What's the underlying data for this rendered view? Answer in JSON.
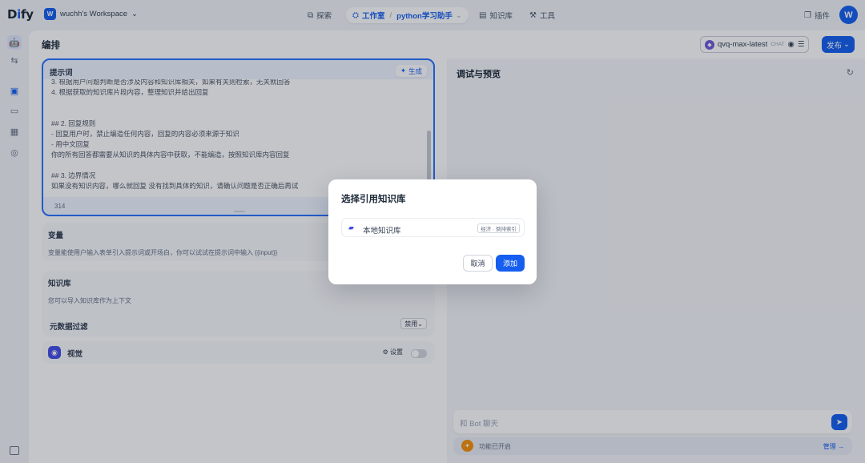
{
  "topbar": {
    "logo_a": "D",
    "logo_i": "i",
    "logo_b": "fy",
    "workspace_initial": "W",
    "workspace_name": "wuchh's Workspace",
    "explore": "探索",
    "studio": "工作室",
    "app_name": "python学习助手",
    "knowledge": "知识库",
    "tools": "工具",
    "plugins": "插件",
    "user_initial": "W"
  },
  "header": {
    "title": "编排",
    "model_name": "qvq-max-latest",
    "model_badge": "CHAT",
    "publish": "发布"
  },
  "prompt": {
    "label": "提示词",
    "generate": "生成",
    "lines": [
      "3. 根据用户问题判断是否涉及内容和知识库相关，如果有关则检索，无关就回答",
      "4. 根据获取的知识库片段内容，整理知识并给出回复",
      "",
      "",
      "## 2. 回复规则",
      "- 回复用户时，禁止编造任何内容，回复的内容必须来源于知识",
      "- 用中文回复",
      "你的所有回答都需要从知识的具体内容中获取，不能编造，按照知识库内容回复",
      "",
      "## 3. 边界情况",
      "如果没有知识内容，哪么就回复 没有找到具体的知识，请确认问题是否正确后再试"
    ],
    "count": "314"
  },
  "variables": {
    "label": "变量",
    "desc": "变量能使用户输入表单引入提示词或开场白，你可以试试在提示词中输入 {{input}}"
  },
  "knowledge_card": {
    "label": "知识库",
    "desc": "您可以导入知识库作为上下文",
    "metadata_filter": "元数据过滤",
    "filter_value": "禁用"
  },
  "vision": {
    "label": "视觉",
    "settings": "设置"
  },
  "debug": {
    "title": "调试与预览",
    "chat_placeholder": "和 Bot 聊天",
    "feature_text": "功能已开启",
    "manage": "管理"
  },
  "modal": {
    "title": "选择引用知识库",
    "kb_name": "本地知识库",
    "kb_tag": "经济 · 倒排索引",
    "cancel": "取消",
    "add": "添加"
  }
}
